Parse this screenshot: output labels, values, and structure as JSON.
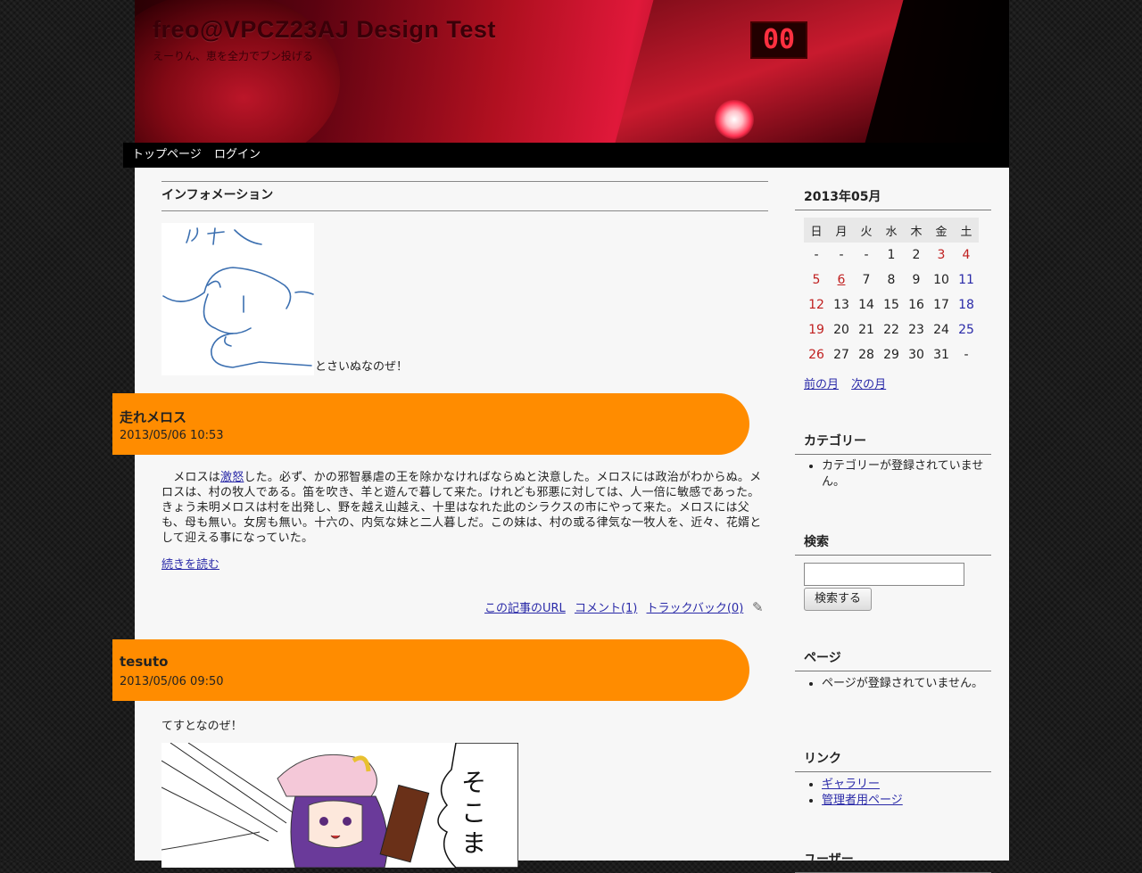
{
  "site": {
    "title": "freo@VPCZ23AJ Design Test",
    "description": "えーりん、恵を全力でブン投げる",
    "led": "00"
  },
  "nav": {
    "items": [
      "トップページ",
      "ログイン"
    ]
  },
  "information": {
    "heading": "インフォメーション",
    "text": "とさいぬなのぜ！"
  },
  "entries": [
    {
      "title": "走れメロス",
      "date": "2013/05/06 10:53",
      "body_pre": "メロスは",
      "body_link": "激怒",
      "body_post": "した。必ず、かの邪智暴虐の王を除かなければならぬと決意した。メロスには政治がわからぬ。メロスは、村の牧人である。笛を吹き、羊と遊んで暮して来た。けれども邪悪に対しては、人一倍に敏感であった。きょう未明メロスは村を出発し、野を越え山越え、十里はなれた此のシラクスの市にやって来た。メロスには父も、母も無い。女房も無い。十六の、内気な妹と二人暮しだ。この妹は、村の或る律気な一牧人を、近々、花婿として迎える事になっていた。",
      "more": "続きを読む",
      "links": [
        "この記事のURL",
        "コメント(1)",
        "トラックバック(0)"
      ]
    },
    {
      "title": "tesuto",
      "date": "2013/05/06 09:50",
      "body": "てすとなのぜ！",
      "image_text": "そこま"
    }
  ],
  "calendar": {
    "heading": "2013年05月",
    "weekdays": [
      "日",
      "月",
      "火",
      "水",
      "木",
      "金",
      "土"
    ],
    "weeks": [
      [
        "-",
        "-",
        "-",
        "1",
        "2",
        "3",
        "4"
      ],
      [
        "5",
        "6",
        "7",
        "8",
        "9",
        "10",
        "11"
      ],
      [
        "12",
        "13",
        "14",
        "15",
        "16",
        "17",
        "18"
      ],
      [
        "19",
        "20",
        "21",
        "22",
        "23",
        "24",
        "25"
      ],
      [
        "26",
        "27",
        "28",
        "29",
        "30",
        "31",
        "-"
      ]
    ],
    "holidays": [
      "3",
      "4",
      "6"
    ],
    "linked_day": "6",
    "prev": "前の月",
    "next": "次の月",
    "colors": {
      "holiday": "#c02020",
      "saturday": "#2a2aa8"
    }
  },
  "category": {
    "heading": "カテゴリー",
    "empty": "カテゴリーが登録されていません。"
  },
  "search": {
    "heading": "検索",
    "button": "検索する",
    "value": ""
  },
  "pages": {
    "heading": "ページ",
    "empty": "ページが登録されていません。"
  },
  "links": {
    "heading": "リンク",
    "items": [
      "ギャラリー",
      "管理者用ページ"
    ]
  },
  "users": {
    "heading": "ユーザー"
  },
  "colors": {
    "accent": "#ff8c00",
    "header_bg": "#000000",
    "link": "#2a2aa8"
  }
}
